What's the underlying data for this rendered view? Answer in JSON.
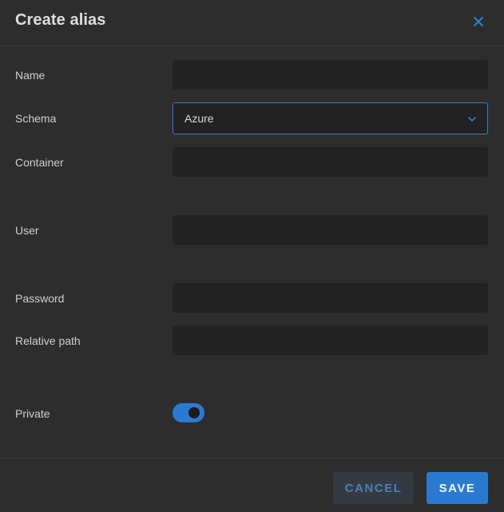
{
  "dialog": {
    "title": "Create alias"
  },
  "fields": {
    "name": {
      "label": "Name",
      "value": "",
      "placeholder": ""
    },
    "schema": {
      "label": "Schema",
      "value": "Azure"
    },
    "container": {
      "label": "Container",
      "value": "",
      "placeholder": ""
    },
    "user": {
      "label": "User",
      "value": "",
      "placeholder": ""
    },
    "password": {
      "label": "Password",
      "value": "",
      "placeholder": ""
    },
    "relative_path": {
      "label": "Relative path",
      "value": "",
      "placeholder": ""
    },
    "private": {
      "label": "Private",
      "checked": true
    }
  },
  "footer": {
    "cancel_label": "CANCEL",
    "save_label": "SAVE"
  },
  "icons": {
    "close": "close-icon",
    "chevron": "chevron-down-icon"
  },
  "colors": {
    "accent": "#2a7ad2",
    "background": "#2d2d2d",
    "input_background": "#222222"
  }
}
